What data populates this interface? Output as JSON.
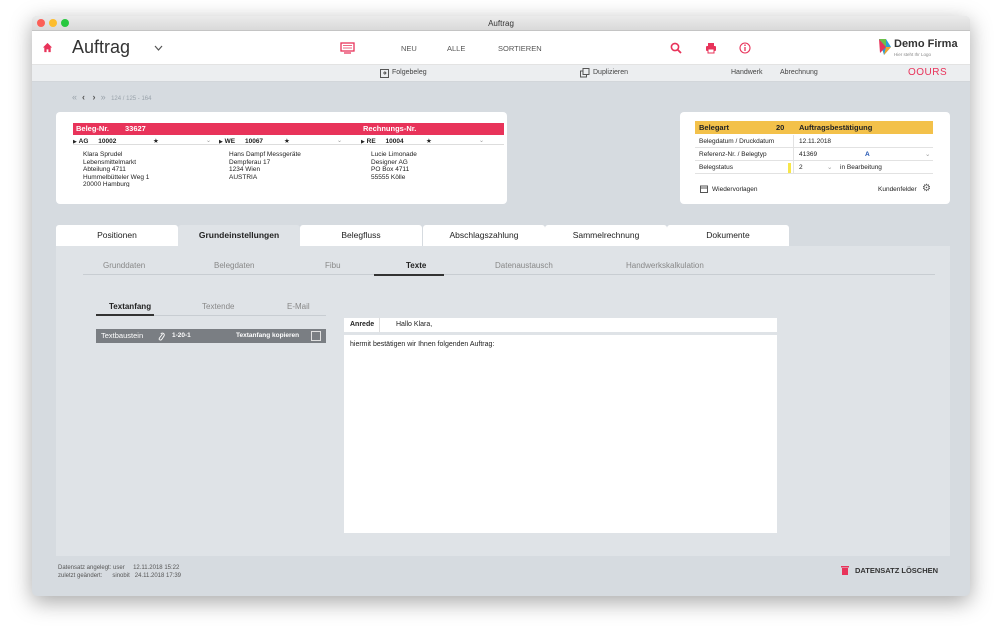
{
  "window": {
    "title": "Auftrag"
  },
  "header": {
    "title": "Auftrag",
    "neu": "NEU",
    "alle": "ALLE",
    "sortieren": "SORTIEREN",
    "company": "Demo Firma",
    "company_sub": "Hier steht Ihr Logo"
  },
  "subbar": {
    "folgebeleg": "Folgebeleg",
    "duplizieren": "Duplizieren",
    "handwerk": "Handwerk",
    "abrechnung": "Abrechnung",
    "brand": "OOURS"
  },
  "record_nav": {
    "counter": "124 / 125 - 164"
  },
  "beleg": {
    "nr_label": "Beleg-Nr.",
    "nr_value": "33627",
    "rechnung_label": "Rechnungs-Nr.",
    "cols": [
      {
        "code": "AG",
        "num": "10002",
        "lines": [
          "Klara Sprudel",
          "Lebensmittelmarkt",
          "Abteilung 4711",
          "Hummelbütteler Weg 1",
          "20000 Hamburg"
        ]
      },
      {
        "code": "WE",
        "num": "10067",
        "lines": [
          "Hans Dampf Messgeräte",
          "Dempferau 17",
          "1234 Wien",
          "AUSTRIA"
        ]
      },
      {
        "code": "RE",
        "num": "10004",
        "lines": [
          "Lucie Limonade",
          "Designer AG",
          "PO Box 4711",
          "55555 Kölle"
        ]
      }
    ]
  },
  "belegart": {
    "label": "Belegart",
    "num": "20",
    "type": "Auftragsbestätigung",
    "rows": [
      {
        "label": "Belegdatum / Druckdatum",
        "value": "12.11.2018",
        "extra": ""
      },
      {
        "label": "Referenz-Nr. / Belegtyp",
        "value": "41369",
        "extra": "A"
      },
      {
        "label": "Belegstatus",
        "value": "2",
        "extra": "in Bearbeitung"
      }
    ],
    "wiedervorlagen": "Wiedervorlagen",
    "kundenfelder": "Kundenfelder"
  },
  "tabs": [
    "Positionen",
    "Grundeinstellungen",
    "Belegfluss",
    "Abschlagszahlung",
    "Sammelrechnung",
    "Dokumente"
  ],
  "subtabs": [
    "Grunddaten",
    "Belegdaten",
    "Fibu",
    "Texte",
    "Datenaustausch",
    "Handwerkskalkulation"
  ],
  "texttabs": [
    "Textanfang",
    "Textende",
    "E-Mail"
  ],
  "textbaustein": {
    "label": "Textbaustein",
    "code": "1-20-1",
    "copy": "Textanfang kopieren"
  },
  "editor": {
    "anrede_label": "Anrede",
    "anrede_value": "Hallo Klara,",
    "body": "hiermit bestätigen wir Ihnen folgenden Auftrag:"
  },
  "footer": {
    "angelegt_label": "Datensatz angelegt:",
    "angelegt_user": "user",
    "angelegt_date": "12.11.2018 15:22",
    "geaendert_label": "zuletzt geändert:",
    "geaendert_user": "sinobit",
    "geaendert_date": "24.11.2018 17:39",
    "delete": "DATENSATZ LÖSCHEN"
  },
  "colors": {
    "accent": "#e8335a",
    "yellow": "#f3c14a"
  }
}
